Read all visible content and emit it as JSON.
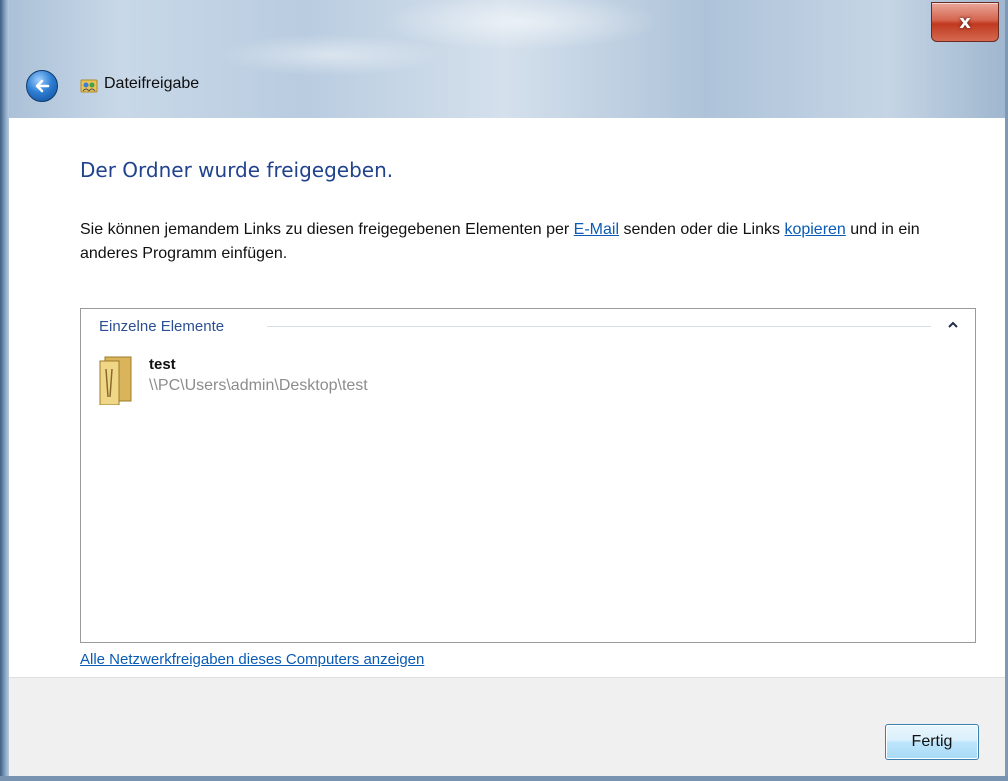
{
  "window": {
    "title": "Dateifreigabe",
    "close_label": "x"
  },
  "main": {
    "heading": "Der Ordner wurde freigegeben.",
    "desc_part1": "Sie können jemandem Links zu diesen freigegebenen Elementen per ",
    "email_link": "E-Mail",
    "desc_part2": " senden oder die Links ",
    "copy_link": "kopieren",
    "desc_part3": " und in ein anderes Programm einfügen."
  },
  "group": {
    "header": "Einzelne Elemente",
    "items": [
      {
        "name": "test",
        "path": "\\\\PC\\Users\\admin\\Desktop\\test",
        "icon": "folder-icon"
      }
    ]
  },
  "all_shares_link": "Alle Netzwerkfreigaben dieses Computers anzeigen",
  "footer": {
    "done_label": "Fertig"
  },
  "colors": {
    "heading": "#21438e",
    "link": "#0a5bb5",
    "close_button": "#c0391f"
  }
}
